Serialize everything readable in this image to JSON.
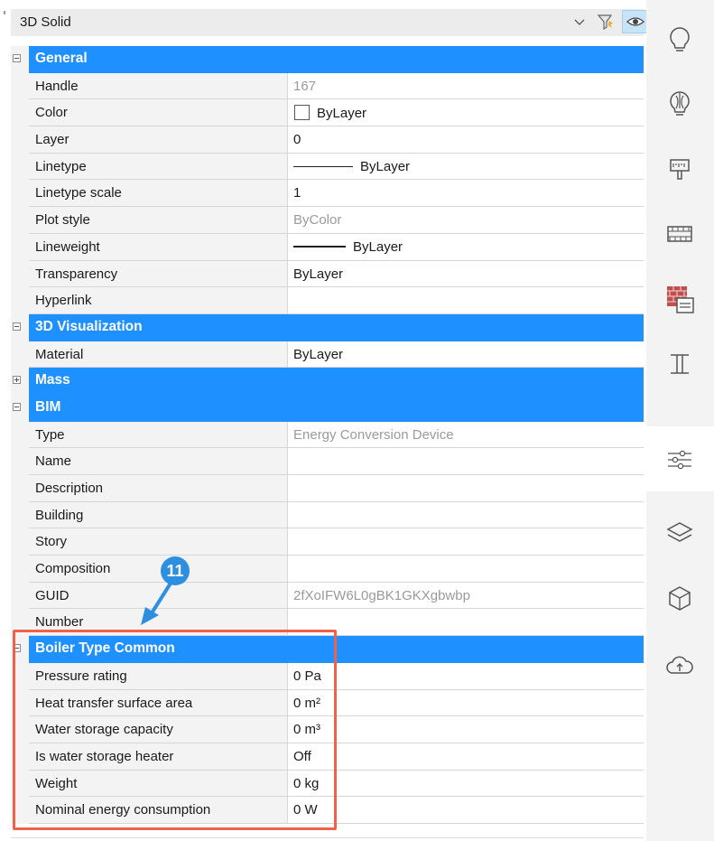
{
  "selector": {
    "value": "3D Solid"
  },
  "callout": {
    "number": "11"
  },
  "groups": [
    {
      "title": "General",
      "expanded": true,
      "rows": [
        {
          "name": "Handle",
          "value": "167",
          "readonly": true
        },
        {
          "name": "Color",
          "value": "ByLayer",
          "kind": "color"
        },
        {
          "name": "Layer",
          "value": "0"
        },
        {
          "name": "Linetype",
          "value": "ByLayer",
          "kind": "linetype"
        },
        {
          "name": "Linetype scale",
          "value": "1"
        },
        {
          "name": "Plot style",
          "value": "ByColor",
          "readonly": true
        },
        {
          "name": "Lineweight",
          "value": "ByLayer",
          "kind": "lineweight"
        },
        {
          "name": "Transparency",
          "value": "ByLayer"
        },
        {
          "name": "Hyperlink",
          "value": ""
        }
      ]
    },
    {
      "title": "3D Visualization",
      "expanded": true,
      "rows": [
        {
          "name": "Material",
          "value": "ByLayer"
        }
      ]
    },
    {
      "title": "Mass",
      "expanded": false,
      "rows": []
    },
    {
      "title": "BIM",
      "expanded": true,
      "rows": [
        {
          "name": "Type",
          "value": "Energy Conversion Device",
          "readonly": true
        },
        {
          "name": "Name",
          "value": ""
        },
        {
          "name": "Description",
          "value": ""
        },
        {
          "name": "Building",
          "value": ""
        },
        {
          "name": "Story",
          "value": ""
        },
        {
          "name": "Composition",
          "value": ""
        },
        {
          "name": "GUID",
          "value": "2fXoIFW6L0gBK1GKXgbwbp",
          "readonly": true
        },
        {
          "name": "Number",
          "value": ""
        }
      ]
    },
    {
      "title": "Boiler Type Common",
      "expanded": true,
      "rows": [
        {
          "name": "Pressure rating",
          "value": "0 Pa"
        },
        {
          "name": "Heat transfer surface area",
          "value": "0 m²"
        },
        {
          "name": "Water storage capacity",
          "value": "0 m³"
        },
        {
          "name": "Is water storage heater",
          "value": "Off"
        },
        {
          "name": "Weight",
          "value": "0 kg"
        },
        {
          "name": "Nominal energy consumption",
          "value": "0 W"
        }
      ]
    }
  ],
  "sidebar": {
    "items": [
      {
        "icon": "lightbulb-icon",
        "active": false
      },
      {
        "icon": "light-sources-icon",
        "active": false
      },
      {
        "icon": "brush-icon",
        "active": false
      },
      {
        "icon": "hatch-icon",
        "active": false
      },
      {
        "icon": "material-browser-icon",
        "active": false
      },
      {
        "icon": "i-beam-icon",
        "active": false
      },
      {
        "icon": "properties-sliders-icon",
        "active": true
      },
      {
        "icon": "layers-icon",
        "active": false
      },
      {
        "icon": "3d-cube-icon",
        "active": false
      },
      {
        "icon": "cloud-upload-icon",
        "active": false
      }
    ]
  },
  "colors": {
    "category_header": "#1e90ff",
    "annotation_box": "#f0614a",
    "callout_badge": "#2d8fe0"
  }
}
